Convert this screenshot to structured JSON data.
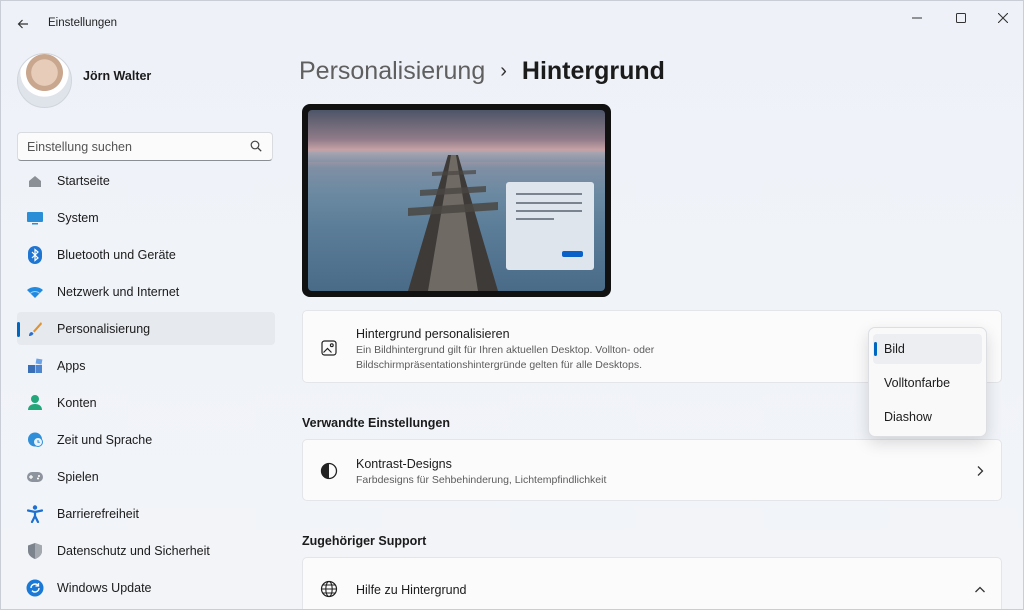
{
  "window": {
    "title": "Einstellungen",
    "controls": [
      "minimize",
      "maximize",
      "close"
    ]
  },
  "profile": {
    "name": "Jörn Walter"
  },
  "search": {
    "placeholder": "Einstellung suchen"
  },
  "sidebar": {
    "items": [
      {
        "label": "Startseite",
        "icon": "home-icon",
        "active": false
      },
      {
        "label": "System",
        "icon": "monitor-icon",
        "active": false
      },
      {
        "label": "Bluetooth und Geräte",
        "icon": "bluetooth-icon",
        "active": false
      },
      {
        "label": "Netzwerk und Internet",
        "icon": "wifi-icon",
        "active": false
      },
      {
        "label": "Personalisierung",
        "icon": "brush-icon",
        "active": true
      },
      {
        "label": "Apps",
        "icon": "apps-icon",
        "active": false
      },
      {
        "label": "Konten",
        "icon": "person-icon",
        "active": false
      },
      {
        "label": "Zeit und Sprache",
        "icon": "globe-clock-icon",
        "active": false
      },
      {
        "label": "Spielen",
        "icon": "gamepad-icon",
        "active": false
      },
      {
        "label": "Barrierefreiheit",
        "icon": "accessibility-icon",
        "active": false
      },
      {
        "label": "Datenschutz und Sicherheit",
        "icon": "shield-icon",
        "active": false
      },
      {
        "label": "Windows Update",
        "icon": "update-icon",
        "active": false
      }
    ]
  },
  "breadcrumb": {
    "parent": "Personalisierung",
    "separator": "›",
    "current": "Hintergrund"
  },
  "background_card": {
    "title": "Hintergrund personalisieren",
    "description": "Ein Bildhintergrund gilt für Ihren aktuellen Desktop. Vollton- oder Bildschirmpräsentationshintergründe gelten für alle Desktops.",
    "icon": "image-icon"
  },
  "dropdown": {
    "options": [
      "Bild",
      "Volltonfarbe",
      "Diashow"
    ],
    "selected": "Bild"
  },
  "related": {
    "heading": "Verwandte Einstellungen",
    "contrast_title": "Kontrast-Designs",
    "contrast_desc": "Farbdesigns für Sehbehinderung, Lichtempfindlichkeit",
    "icon": "contrast-icon"
  },
  "support": {
    "heading": "Zugehöriger Support",
    "help_title": "Hilfe zu Hintergrund",
    "icon": "globe-icon"
  },
  "colors": {
    "accent": "#0067c0",
    "background": "#f0f4f9",
    "card": "#fbfbfc"
  }
}
